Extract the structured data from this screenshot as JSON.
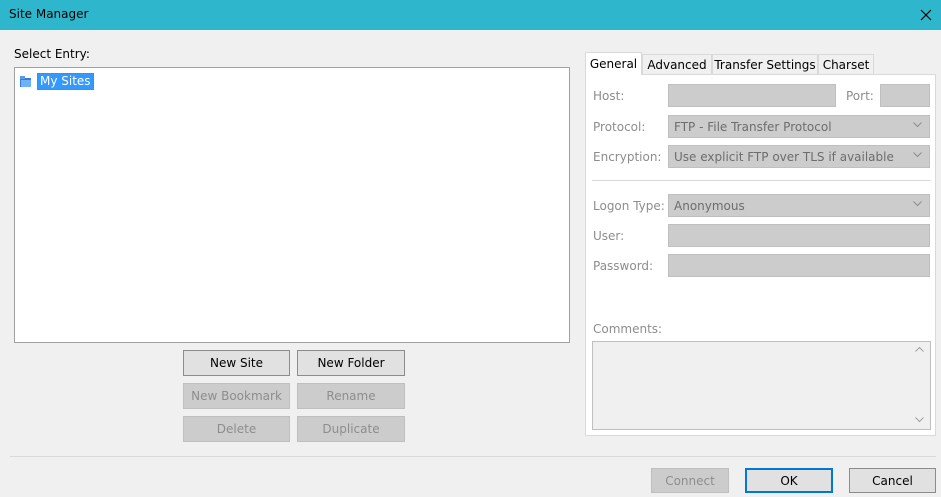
{
  "window": {
    "title": "Site Manager",
    "accent": "#2eb6cc"
  },
  "left": {
    "select_entry_label": "Select Entry:",
    "tree": [
      {
        "label": "My Sites",
        "icon": "folder-icon",
        "selected": true
      }
    ],
    "buttons": {
      "new_site": "New Site",
      "new_folder": "New Folder",
      "new_bookmark": "New Bookmark",
      "rename": "Rename",
      "delete": "Delete",
      "duplicate": "Duplicate"
    }
  },
  "tabs": [
    "General",
    "Advanced",
    "Transfer Settings",
    "Charset"
  ],
  "general": {
    "host_label": "Host:",
    "host_value": "",
    "port_label": "Port:",
    "port_value": "",
    "protocol_label": "Protocol:",
    "protocol_value": "FTP - File Transfer Protocol",
    "encryption_label": "Encryption:",
    "encryption_value": "Use explicit FTP over TLS if available",
    "logon_type_label": "Logon Type:",
    "logon_type_value": "Anonymous",
    "user_label": "User:",
    "user_value": "",
    "password_label": "Password:",
    "password_value": "",
    "comments_label": "Comments:",
    "comments_value": ""
  },
  "footer": {
    "connect": "Connect",
    "ok": "OK",
    "cancel": "Cancel"
  }
}
